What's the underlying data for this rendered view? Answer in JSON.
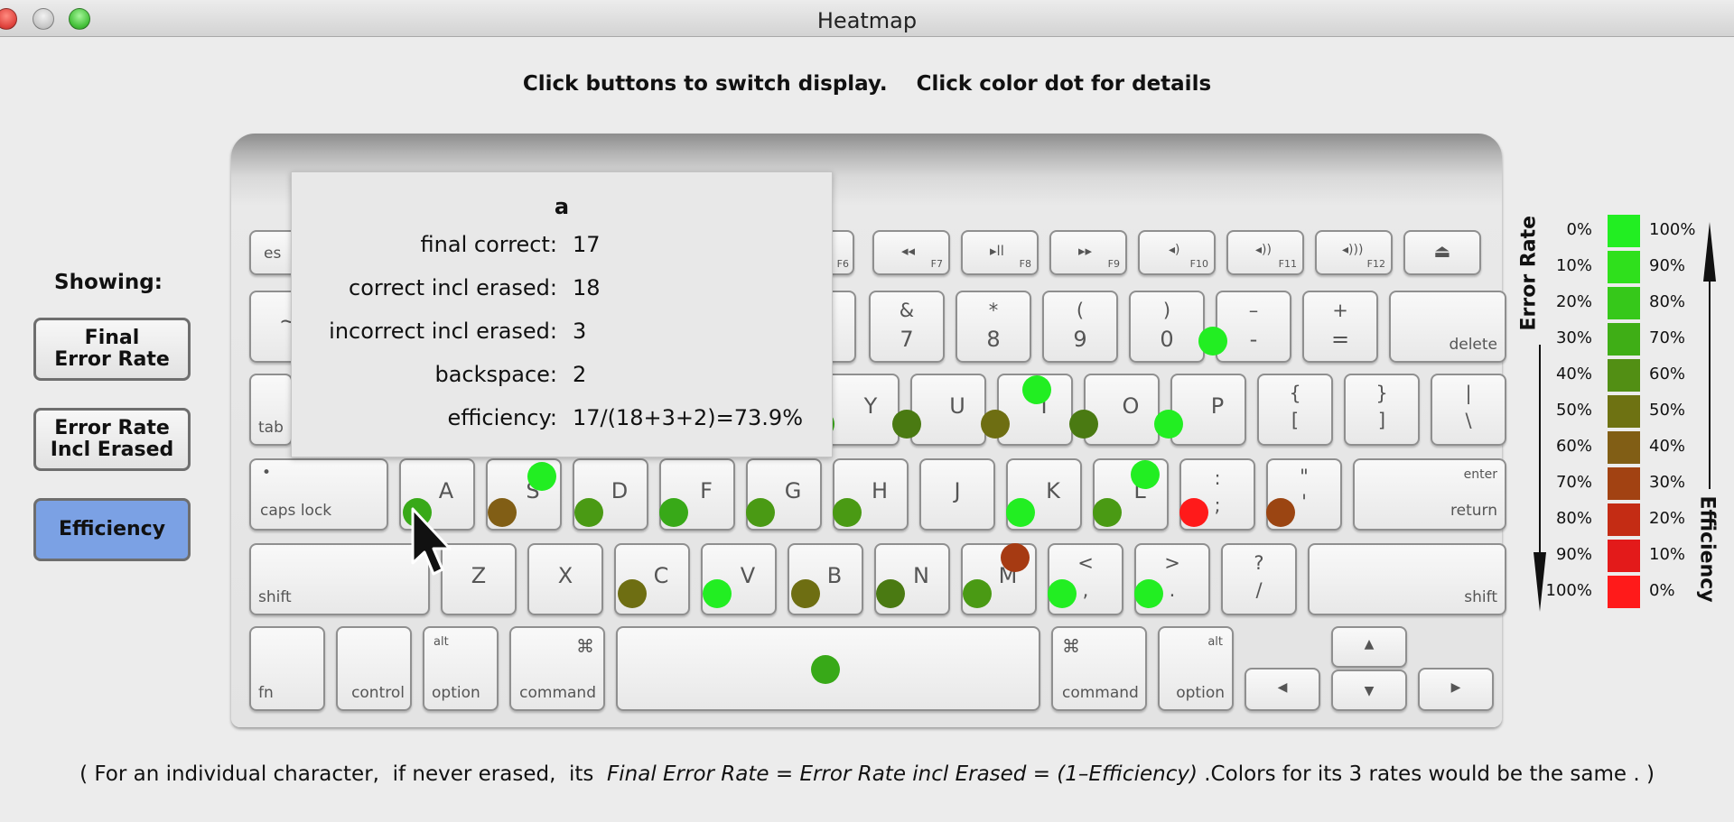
{
  "window": {
    "title": "Heatmap"
  },
  "instructions": "Click buttons to switch display.    Click color dot for details",
  "sidebar": {
    "showing_label": "Showing:",
    "buttons": [
      {
        "label": "Final\nError Rate",
        "selected": false
      },
      {
        "label": "Error Rate\nIncl Erased",
        "selected": false
      },
      {
        "label": "Efficiency",
        "selected": true
      }
    ]
  },
  "keyboard": {
    "function_row": {
      "esc": "es",
      "f6": "F6",
      "f7": "F7",
      "f8": "F8",
      "f9": "F9",
      "f10": "F10",
      "f11": "F11",
      "f12": "F12",
      "eject": "⏏",
      "rewind": "◂◂",
      "play_pause": "▸ll",
      "fast_forward": "▸▸",
      "mute": "◂)",
      "vol_down": "◂))",
      "vol_up": "◂)))"
    },
    "number_row": {
      "tilde": "~",
      "amp_top": "&",
      "seven": "7",
      "star_top": "*",
      "eight": "8",
      "lparen_top": "(",
      "nine": "9",
      "rparen_top": ")",
      "zero": "0",
      "minus_top": "–",
      "minus": "-",
      "plus_top": "+",
      "equals": "=",
      "delete": "delete"
    },
    "top_row": {
      "tab": "tab",
      "y": "Y",
      "u": "U",
      "i": "I",
      "o": "O",
      "p": "P",
      "lbrace_top": "{",
      "lbrace": "[",
      "rbrace_top": "}",
      "rbrace": "]",
      "pipe_top": "|",
      "backslash": "\\"
    },
    "home_row": {
      "caps_dot": "•",
      "caps": "caps lock",
      "a": "A",
      "s": "S",
      "d": "D",
      "f": "F",
      "g": "G",
      "h": "H",
      "j": "J",
      "k": "K",
      "l": "L",
      "colon_top": ":",
      "semicolon": ";",
      "quote_top": "\"",
      "quote": "'",
      "enter": "enter",
      "return": "return"
    },
    "bottom_row": {
      "shift": "shift",
      "z": "Z",
      "x": "X",
      "c": "C",
      "v": "V",
      "b": "B",
      "n": "N",
      "m": "M",
      "lt_top": "<",
      "comma": ",",
      "gt_top": ">",
      "period": ".",
      "q_top": "?",
      "slash": "/",
      "shift_r": "shift"
    },
    "space_row": {
      "fn": "fn",
      "control": "control",
      "alt": "alt",
      "option": "option",
      "cmd_glyph": "⌘",
      "command": "command",
      "up": "▲",
      "down": "▼",
      "left": "◀",
      "right": "▶"
    }
  },
  "dot_colors": {
    "a": "#38a918",
    "s": "#815e15",
    "s_alt": "#22ee22",
    "d": "#4a9a14",
    "f": "#38a918",
    "g": "#4a9a14",
    "h": "#4a9a14",
    "k": "#22ee22",
    "l": "#4a9a14",
    "l_alt": "#22ee22",
    "semicolon": "#ff1a1a",
    "quote": "#9b4512",
    "u": "#4a7a12",
    "i": "#6e6e12",
    "i_alt": "#22ee22",
    "o": "#4a7a12",
    "p": "#22ee22",
    "y": "#38a918",
    "c": "#6e6e12",
    "v": "#22ee22",
    "b": "#6e6e12",
    "n": "#4a7a12",
    "m": "#4a9a14",
    "m_alt": "#a63a12",
    "comma": "#22ee22",
    "period": "#22ee22",
    "minus": "#22ee22",
    "space": "#38a918"
  },
  "popup": {
    "title": "a",
    "rows": [
      {
        "label": "final correct:",
        "value": "17"
      },
      {
        "label": "correct incl erased:",
        "value": "18"
      },
      {
        "label": "incorrect incl erased:",
        "value": "3"
      },
      {
        "label": "backspace:",
        "value": "2"
      },
      {
        "label": "efficiency:",
        "value": "17/(18+3+2)=73.9%"
      }
    ]
  },
  "legend": {
    "left_axis_label": "Error Rate",
    "right_axis_label": "Efficiency",
    "rows": [
      {
        "error": "0%",
        "efficiency": "100%",
        "color": "#22ee22"
      },
      {
        "error": "10%",
        "efficiency": "90%",
        "color": "#2fe01c"
      },
      {
        "error": "20%",
        "efficiency": "80%",
        "color": "#36c81a"
      },
      {
        "error": "30%",
        "efficiency": "70%",
        "color": "#3fae16"
      },
      {
        "error": "40%",
        "efficiency": "60%",
        "color": "#528f14"
      },
      {
        "error": "50%",
        "efficiency": "50%",
        "color": "#6e7212"
      },
      {
        "error": "60%",
        "efficiency": "40%",
        "color": "#815e15"
      },
      {
        "error": "70%",
        "efficiency": "30%",
        "color": "#a24212"
      },
      {
        "error": "80%",
        "efficiency": "20%",
        "color": "#c42c14"
      },
      {
        "error": "90%",
        "efficiency": "10%",
        "color": "#e31a1a"
      },
      {
        "error": "100%",
        "efficiency": "0%",
        "color": "#ff1a1a"
      }
    ]
  },
  "footnote": {
    "pre": "( For an individual character,  if never erased,  its  ",
    "formula": "Final Error Rate = Error Rate incl Erased = (1–Efficiency)",
    "post": " .Colors for its 3 rates would be the same . )"
  }
}
